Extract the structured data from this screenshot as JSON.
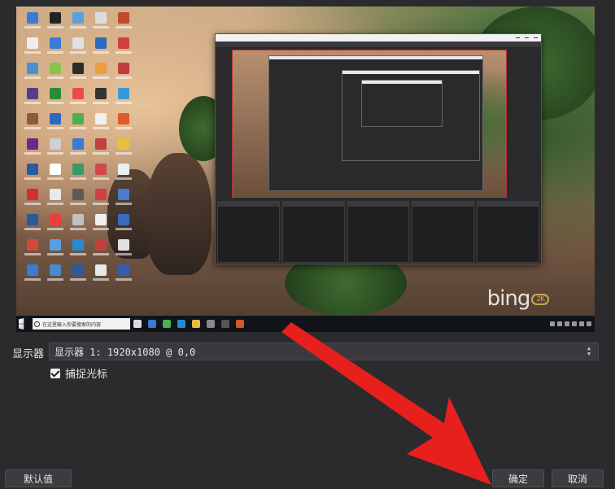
{
  "preview": {
    "search_placeholder": "在这里输入你要搜索的内容",
    "watermark_text": "bing",
    "watermark_badge": "2K"
  },
  "display": {
    "label": "显示器",
    "selected_value": "显示器 1: 1920x1080 @ 0,0"
  },
  "capture_cursor": {
    "label": "捕捉光标",
    "checked": true
  },
  "buttons": {
    "defaults": "默认值",
    "ok": "确定",
    "cancel": "取消"
  },
  "colors": {
    "dialog_bg": "#2b2b2e",
    "annotation_arrow": "#e8201d"
  },
  "icons": {
    "checkbox": "check-icon",
    "select_chevron": "chevron-updown-icon",
    "annotation": "red-arrow-annotation"
  }
}
